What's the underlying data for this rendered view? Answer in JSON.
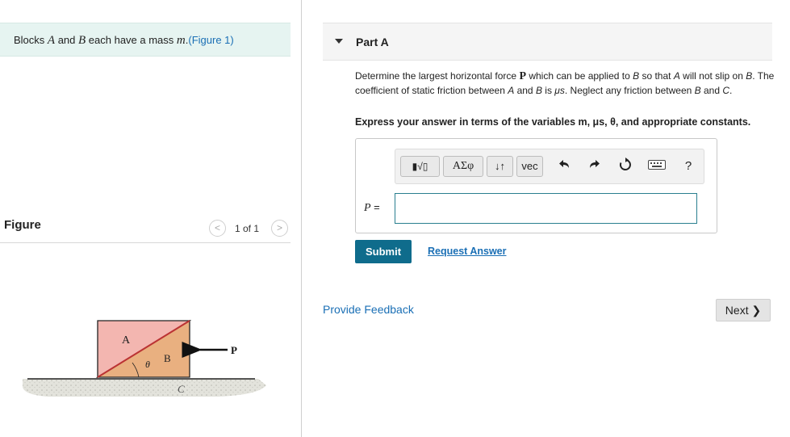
{
  "problem": {
    "intro_before": "Blocks ",
    "var_a": "A",
    "mid_and": " and ",
    "var_b": "B",
    "mid_mass": " each have a mass ",
    "var_m": "m",
    "after_mass": ".",
    "figure_link": "(Figure 1)"
  },
  "figure": {
    "title": "Figure",
    "page_count": "1 of 1",
    "prev_symbol": "<",
    "next_symbol": ">",
    "label_a": "A",
    "label_b": "B",
    "label_c": "C",
    "label_theta": "θ",
    "label_p": "P"
  },
  "part": {
    "title": "Part A",
    "q1": "Determine the largest horizontal force ",
    "q_p": "P",
    "q2": " which can be applied to ",
    "q_b1": "B",
    "q3": " so that ",
    "q_a1": "A",
    "q4": " will not slip on ",
    "q_b2": "B",
    "q5": ". The coefficient of static friction between ",
    "q_a2": "A",
    "q6": " and ",
    "q_b3": "B",
    "q7": " is ",
    "q_mu": "μs",
    "q8": ". Neglect any friction between ",
    "q_b4": "B",
    "q9": " and ",
    "q_c": "C",
    "q10": ".",
    "instruction": "Express your answer in terms of the variables m, μs, θ, and appropriate constants."
  },
  "toolbar": {
    "template_btn": "▮√▯",
    "greek_btn": "ΑΣφ",
    "arrows_btn": "↓↑",
    "vec_btn": "vec",
    "undo_icon": "undo-icon",
    "redo_icon": "redo-icon",
    "reset_icon": "reset-icon",
    "keyboard_icon": "keyboard-icon",
    "help_label": "?"
  },
  "answer": {
    "label_var": "P",
    "label_eq": " =",
    "value": ""
  },
  "actions": {
    "submit": "Submit",
    "request_answer": "Request Answer",
    "provide_feedback": "Provide Feedback",
    "next": "Next ❯"
  },
  "colors": {
    "accent": "#0f6c8c",
    "link": "#1a6fb5",
    "banner_bg": "#e6f4f1",
    "block_a": "#f3b6b0",
    "block_b": "#e9b080"
  }
}
